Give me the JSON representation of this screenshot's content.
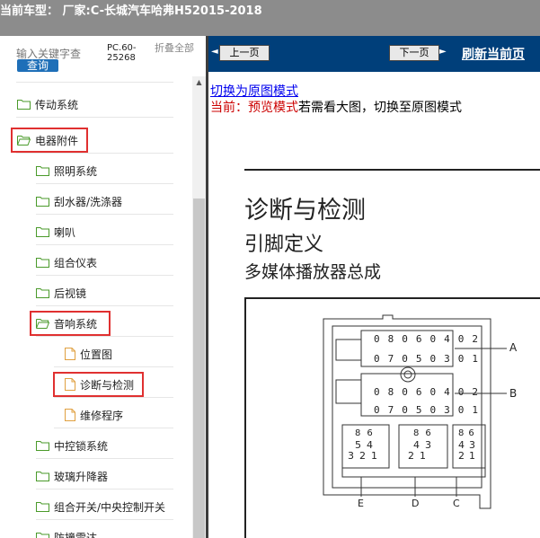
{
  "header": {
    "title": "当前车型：  厂家:C-长城汽车哈弗H52015-2018"
  },
  "sidebar": {
    "search_placeholder": "输入关键字查",
    "query_label": "查询",
    "pc_label": "PC.60-25268",
    "collapse_label": "折叠全部",
    "items": [
      {
        "label": "传动系统",
        "icon": "folder-icon",
        "level": 0
      },
      {
        "label": "电器附件",
        "icon": "folder-open-icon",
        "level": 0
      },
      {
        "label": "照明系统",
        "icon": "folder-icon",
        "level": 1
      },
      {
        "label": "刮水器/洗涤器",
        "icon": "folder-icon",
        "level": 1
      },
      {
        "label": "喇叭",
        "icon": "folder-icon",
        "level": 1
      },
      {
        "label": "组合仪表",
        "icon": "folder-icon",
        "level": 1
      },
      {
        "label": "后视镜",
        "icon": "folder-icon",
        "level": 1
      },
      {
        "label": "音响系统",
        "icon": "folder-open-icon",
        "level": 1
      },
      {
        "label": "位置图",
        "icon": "document-icon",
        "level": 2
      },
      {
        "label": "诊断与检测",
        "icon": "document-icon",
        "level": 2
      },
      {
        "label": "维修程序",
        "icon": "document-icon",
        "level": 2
      },
      {
        "label": "中控锁系统",
        "icon": "folder-icon",
        "level": 1
      },
      {
        "label": "玻璃升降器",
        "icon": "folder-icon",
        "level": 1
      },
      {
        "label": "组合开关/中央控制开关",
        "icon": "folder-icon",
        "level": 1
      },
      {
        "label": "防撞雷达",
        "icon": "folder-icon",
        "level": 1
      }
    ]
  },
  "toolbar": {
    "prev_label": "上一页",
    "next_label": "下一页",
    "refresh_label": "刷新当前页"
  },
  "content": {
    "switch_link": "切换为原图模式",
    "status_prefix": "当前：",
    "status_mode": "预览模式",
    "status_suffix": "若需看大图，切换至原图模式",
    "heading1": "诊断与检测",
    "heading2": "引脚定义",
    "heading3": "多媒体播放器总成"
  },
  "diagram": {
    "top_row_a": [
      "08",
      "06",
      "04",
      "02"
    ],
    "bottom_row_a": [
      "07",
      "05",
      "03",
      "01"
    ],
    "top_row_b": [
      "08",
      "06",
      "04",
      "02"
    ],
    "bottom_row_b": [
      "07",
      "05",
      "03",
      "01"
    ],
    "label_a": "A",
    "label_b": "B",
    "label_c": "C",
    "label_d": "D",
    "label_e": "E",
    "e_top": [
      "8",
      "6"
    ],
    "e_mid": [
      "5",
      "4"
    ],
    "e_bot": [
      "3",
      "2",
      "1"
    ],
    "d_top": [
      "8",
      "6"
    ],
    "d_mid": [
      "4",
      "3"
    ],
    "d_bot": [
      "2",
      "1"
    ],
    "c_top": [
      "8",
      "6"
    ],
    "c_mid": [
      "4",
      "3"
    ],
    "c_bot": [
      "2",
      "1"
    ]
  },
  "colors": {
    "topbar": "#8c8c8c",
    "navbar": "#003f7a",
    "highlight": "#e03030",
    "link": "#0000ee",
    "status_red": "#cc0000"
  }
}
